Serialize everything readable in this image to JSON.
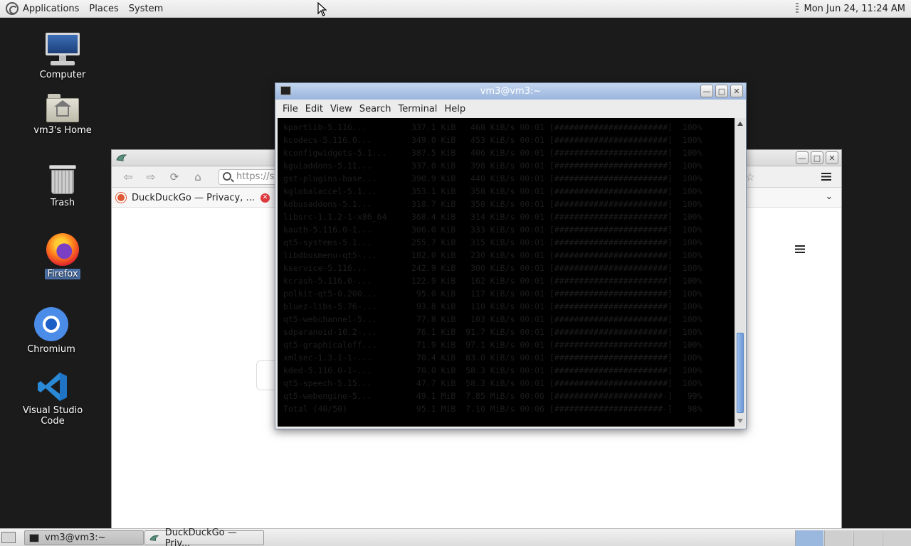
{
  "top_panel": {
    "menus": [
      "Applications",
      "Places",
      "System"
    ],
    "clock": "Mon Jun 24, 11:24 AM"
  },
  "desktop": {
    "icons": [
      {
        "label": "Computer",
        "icon": "computer-icon"
      },
      {
        "label": "vm3's Home",
        "icon": "home-folder-icon"
      },
      {
        "label": "Trash",
        "icon": "trash-icon"
      },
      {
        "label": "Firefox",
        "icon": "firefox-icon",
        "selected": true
      },
      {
        "label": "Chromium",
        "icon": "chromium-icon"
      },
      {
        "label": "Visual Studio Code",
        "icon": "vscode-icon"
      }
    ]
  },
  "browser": {
    "url_partial": "https://st",
    "tab_title": "DuckDuckGo — Privacy, ..."
  },
  "terminal": {
    "title": "vm3@vm3:~",
    "menu": [
      "File",
      "Edit",
      "View",
      "Search",
      "Terminal",
      "Help"
    ],
    "lines": [
      "kpartlib-5.116...         337.1 KiB   468 KiB/s 00:01 [#######################]  100%",
      "kcodecs-5.116.0...        349.0 KiB   453 KiB/s 00:01 [#######################]  100%",
      "kconfigwidgets-5.1...     387.5 KiB   406 KiB/s 00:01 [#######################]  100%",
      "kguiaddons-5.11...        337.0 KiB   398 KiB/s 00:01 [#######################]  100%",
      "gst-plugins-base...       390.9 KiB   440 KiB/s 00:01 [#######################]  100%",
      "kglobalaccel-5.1...       353.1 KiB   358 KiB/s 00:01 [#######################]  100%",
      "kdbusaddons-5.1...        318.7 KiB   358 KiB/s 00:01 [#######################]  100%",
      "libsrc-1.1.2-1-x86_64     368.4 KiB   314 KiB/s 00:01 [#######################]  100%",
      "kauth-5.116.0-1...        306.0 KiB   333 KiB/s 00:01 [#######################]  100%",
      "qt5-systems-5.1...        255.7 KiB   315 KiB/s 00:01 [#######################]  100%",
      "libdbusmenu-qt5-...       182.0 KiB   230 KiB/s 00:01 [#######################]  100%",
      "kservice-5.116...         242.9 KiB   300 KiB/s 00:01 [#######################]  100%",
      "kcrash-5.116.0-...        122.9 KiB   162 KiB/s 00:01 [#######################]  100%",
      "polkit-qt5-0.200...        95.0 KiB   117 KiB/s 00:01 [#######################]  100%",
      "bluez-libs-5.76-...        93.8 KiB   110 KiB/s 00:01 [#######################]  100%",
      "qt5-webchannel-5...        77.8 KiB   103 KiB/s 00:01 [#######################]  100%",
      "sdparanoid-10.2-...        76.1 KiB  91.7 KiB/s 00:01 [#######################]  100%",
      "qt5-graphicaleff...        71.9 KiB  97.1 KiB/s 00:01 [#######################]  100%",
      "xmlsec-1.3.1-1-...         70.4 KiB  83.0 KiB/s 00:01 [#######################]  100%",
      "kded-5.116.0-1-...         70.0 KiB  58.3 KiB/s 00:01 [#######################]  100%",
      "qt5-speech-5.15...         47.7 KiB  58.3 KiB/s 00:01 [#######################]  100%",
      "qt5-webengine-5...         49.1 MiB  7.85 MiB/s 00:06 [######################-]   99%",
      "Total (40/50)              95.1 MiB  7.10 MiB/s 00:06 [######################-]   98%"
    ]
  },
  "taskbar": {
    "items": [
      "vm3@vm3:~",
      "DuckDuckGo — Priv..."
    ]
  }
}
